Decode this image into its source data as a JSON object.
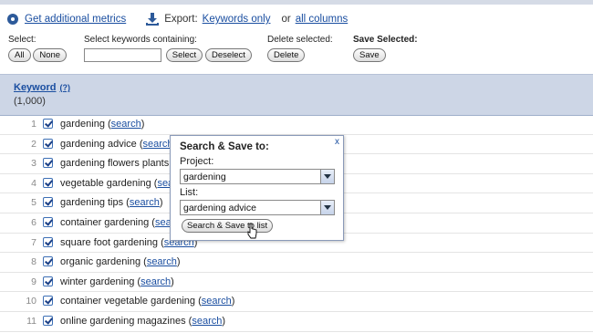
{
  "toolbar": {
    "metrics_link": "Get additional metrics",
    "export_label": "Export:",
    "keywords_only_link": "Keywords only",
    "or_text": "or",
    "all_columns_link": "all columns"
  },
  "controls": {
    "select_label": "Select:",
    "all_button": "All",
    "none_button": "None",
    "containing_label": "Select keywords containing:",
    "containing_value": "",
    "select_button": "Select",
    "deselect_button": "Deselect",
    "delete_label": "Delete selected:",
    "delete_button": "Delete",
    "save_label": "Save Selected:",
    "save_button": "Save"
  },
  "header": {
    "column_title": "Keyword",
    "help": "(?)",
    "count": "(1,000)"
  },
  "search_link_text": "search",
  "rows": [
    {
      "num": "1",
      "keyword": "gardening",
      "checked": true
    },
    {
      "num": "2",
      "keyword": "gardening advice",
      "checked": true
    },
    {
      "num": "3",
      "keyword": "gardening flowers plants",
      "checked": true
    },
    {
      "num": "4",
      "keyword": "vegetable gardening",
      "checked": true
    },
    {
      "num": "5",
      "keyword": "gardening tips",
      "checked": true
    },
    {
      "num": "6",
      "keyword": "container gardening",
      "checked": true
    },
    {
      "num": "7",
      "keyword": "square foot gardening",
      "checked": true
    },
    {
      "num": "8",
      "keyword": "organic gardening",
      "checked": true
    },
    {
      "num": "9",
      "keyword": "winter gardening",
      "checked": true
    },
    {
      "num": "10",
      "keyword": "container vegetable gardening",
      "checked": true
    },
    {
      "num": "11",
      "keyword": "online gardening magazines",
      "checked": true
    }
  ],
  "popup": {
    "close": "x",
    "title": "Search & Save to:",
    "project_label": "Project:",
    "project_value": "gardening",
    "list_label": "List:",
    "list_value": "gardening advice",
    "submit_button": "Search & Save to list"
  },
  "colors": {
    "link": "#1a4ea0",
    "header_bg": "#cdd6e6",
    "checkbox": "#3d6fb5"
  }
}
